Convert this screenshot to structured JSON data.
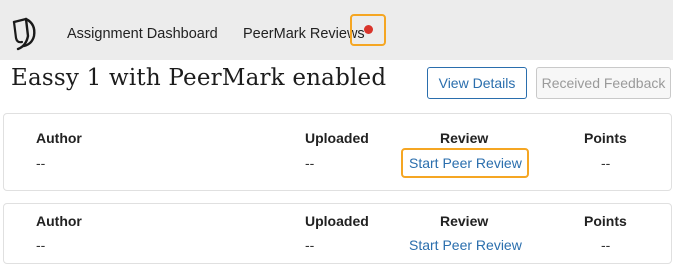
{
  "nav": {
    "logo_icon": "turnitin-logo-icon",
    "items": [
      {
        "label": "Assignment Dashboard"
      },
      {
        "label": "PeerMark Reviews"
      }
    ],
    "notification_color": "#d9342b",
    "highlight_color": "#f5a623"
  },
  "header": {
    "title": "Eassy 1 with PeerMark enabled",
    "view_details_label": "View Details",
    "received_feedback_label": "Received Feedback"
  },
  "reviews": {
    "columns": [
      "Author",
      "Uploaded",
      "Review",
      "Points"
    ],
    "rows": [
      {
        "author": "--",
        "uploaded": "--",
        "review": "Start Peer Review",
        "points": "--"
      },
      {
        "author": "--",
        "uploaded": "--",
        "review": "Start Peer Review",
        "points": "--"
      }
    ]
  },
  "colors": {
    "accent": "#2a6ead",
    "nav_bg": "#ececec"
  }
}
